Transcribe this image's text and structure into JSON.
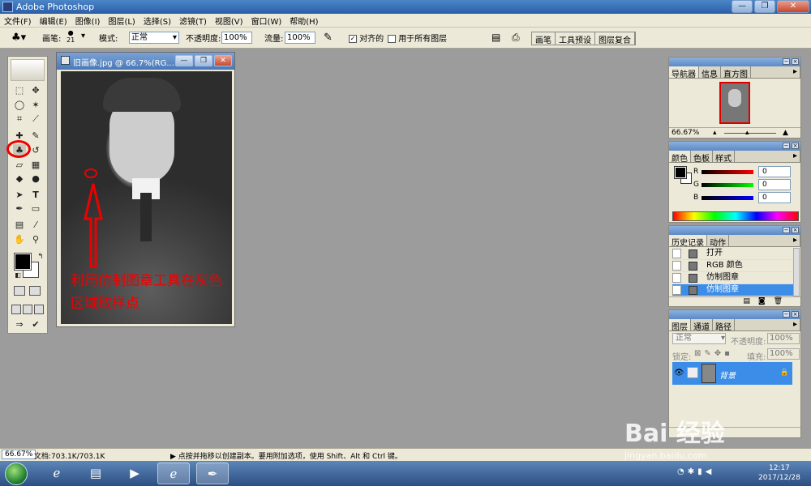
{
  "app": {
    "title": "Adobe Photoshop"
  },
  "window_buttons": {
    "minimize": "—",
    "restore": "❐",
    "close": "✕"
  },
  "menu": [
    "文件(F)",
    "编辑(E)",
    "图像(I)",
    "图层(L)",
    "选择(S)",
    "滤镜(T)",
    "视图(V)",
    "窗口(W)",
    "帮助(H)"
  ],
  "options_bar": {
    "brush_label": "画笔:",
    "brush_size": "21",
    "mode_label": "模式:",
    "mode_value": "正常",
    "opacity_label": "不透明度:",
    "opacity_value": "100%",
    "flow_label": "流量:",
    "flow_value": "100%",
    "aligned_label": "对齐的",
    "aligned_checked": true,
    "all_layers_label": "用于所有图层",
    "all_layers_checked": false,
    "well_tabs": [
      "画笔",
      "工具预设",
      "图层复合"
    ]
  },
  "document": {
    "title": "旧画像.jpg @ 66.7%(RG...",
    "annotation": "利用仿制图章工具在灰色区域取样点"
  },
  "navigator": {
    "tabs": [
      "导航器",
      "信息",
      "直方图"
    ],
    "zoom": "66.67%"
  },
  "color_panel": {
    "tabs": [
      "颜色",
      "色板",
      "样式"
    ],
    "channels": [
      {
        "label": "R",
        "value": "0",
        "color": "#cc0000"
      },
      {
        "label": "G",
        "value": "0",
        "color": "#009900"
      },
      {
        "label": "B",
        "value": "0",
        "color": "#0000cc"
      }
    ]
  },
  "history_panel": {
    "tabs": [
      "历史记录",
      "动作"
    ],
    "items": [
      {
        "label": "打开",
        "selected": false
      },
      {
        "label": "RGB 颜色",
        "selected": false
      },
      {
        "label": "仿制图章",
        "selected": false
      },
      {
        "label": "仿制图章",
        "selected": true
      }
    ]
  },
  "layers_panel": {
    "tabs": [
      "图层",
      "通道",
      "路径"
    ],
    "blend_mode": "正常",
    "opacity_label": "不透明度:",
    "opacity_value": "100%",
    "lock_label": "锁定:",
    "fill_label": "填充:",
    "fill_value": "100%",
    "layer_name": "背景"
  },
  "status_bar": {
    "zoom": "66.67%",
    "doc_info": "文档:703.1K/703.1K",
    "hint": "▶  点按并拖移以创建副本。要用附加选项，使用 Shift、Alt 和 Ctrl 键。"
  },
  "taskbar": {
    "time": "12:17",
    "date": "2017/12/28"
  },
  "watermark": {
    "brand": "Bai 经验",
    "url": "jingyan.baidu.com"
  }
}
